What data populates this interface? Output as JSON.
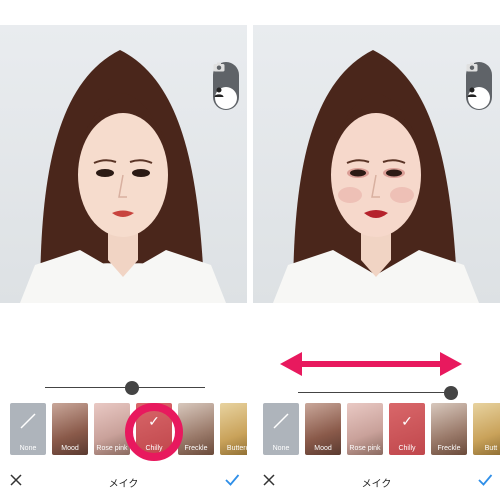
{
  "colors": {
    "accent_check": "#2f8fe8",
    "annotation": "#e8195e",
    "toggle_bg": "#5f6368",
    "hair": "#4a261b",
    "jacket": "#f7f7f5"
  },
  "icons": {
    "camera": "camera-icon",
    "person": "person-icon",
    "close": "close-icon",
    "confirm": "checkmark-icon"
  },
  "left": {
    "slider_level": 0.55,
    "filters": [
      {
        "name": "None"
      },
      {
        "name": "Mood"
      },
      {
        "name": "Rose pink"
      },
      {
        "name": "Chilly",
        "selected": true
      },
      {
        "name": "Freckle"
      },
      {
        "name": "Butterc"
      }
    ],
    "bottombar": {
      "title": "メイク"
    }
  },
  "right": {
    "slider_level": 1.0,
    "filters": [
      {
        "name": "None"
      },
      {
        "name": "Mood"
      },
      {
        "name": "Rose pink"
      },
      {
        "name": "Chilly",
        "selected": true
      },
      {
        "name": "Freckle"
      },
      {
        "name": "Butt"
      }
    ],
    "bottombar": {
      "title": "メイク"
    }
  }
}
